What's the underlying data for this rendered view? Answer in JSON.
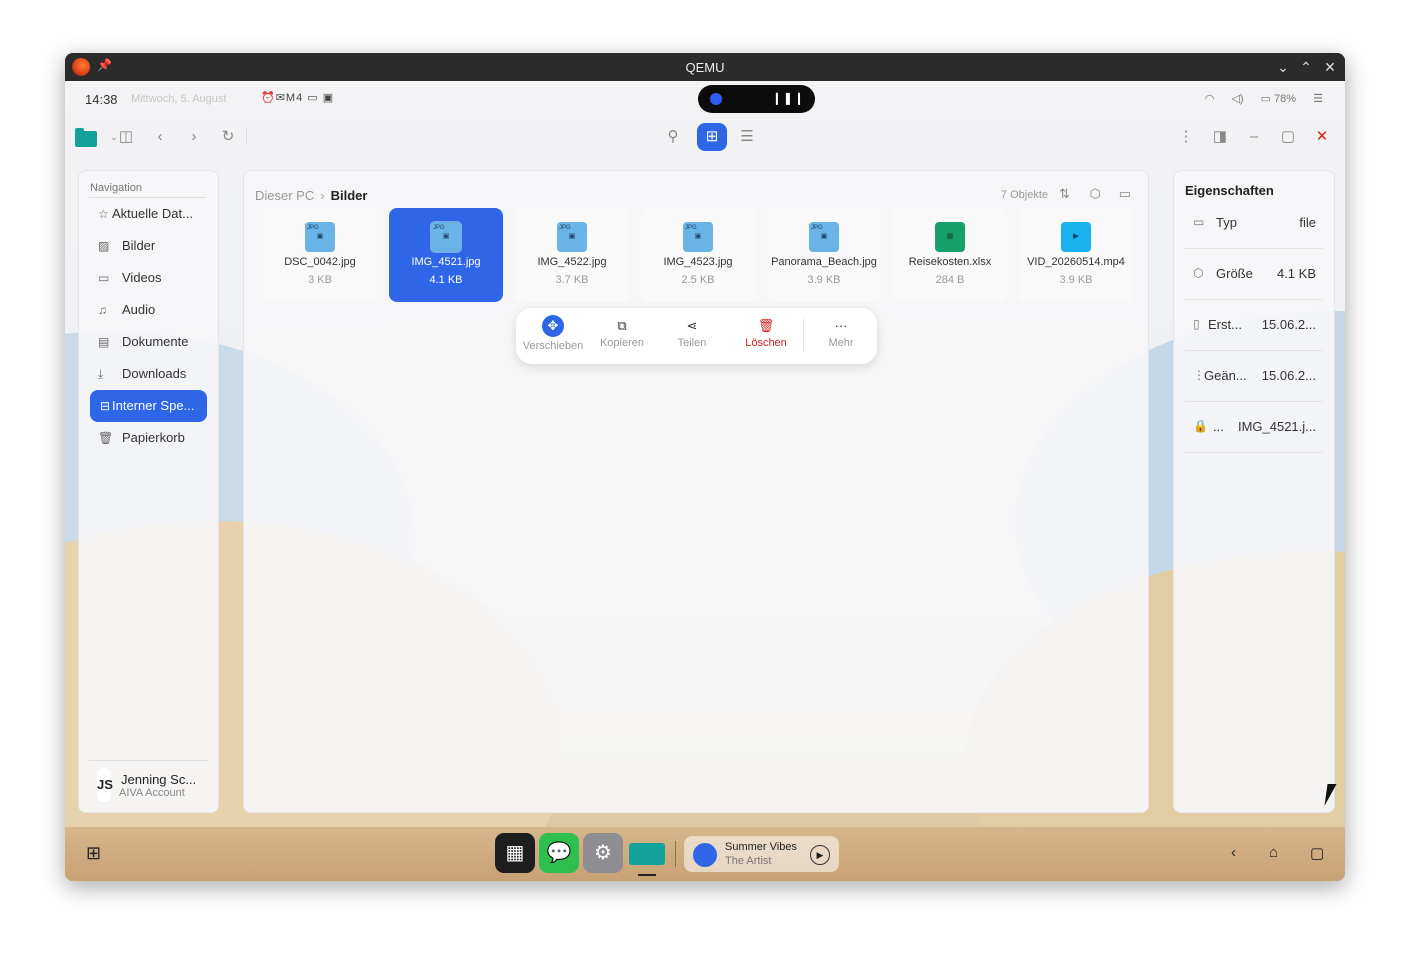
{
  "window": {
    "title": "QEMU"
  },
  "status": {
    "time": "14:38",
    "date": "Mittwoch, 5. August",
    "notif_text": "M4",
    "battery": "78%",
    "accent": "#2f66e8"
  },
  "navigation": {
    "heading": "Navigation",
    "items": [
      {
        "label": "Aktuelle Dat...",
        "icon": "star-icon"
      },
      {
        "label": "Bilder",
        "icon": "image-icon"
      },
      {
        "label": "Videos",
        "icon": "video-icon"
      },
      {
        "label": "Audio",
        "icon": "music-icon"
      },
      {
        "label": "Dokumente",
        "icon": "document-icon"
      },
      {
        "label": "Downloads",
        "icon": "download-icon"
      },
      {
        "label": "Interner Spe...",
        "icon": "drive-icon",
        "active": true
      },
      {
        "label": "Papierkorb",
        "icon": "trash-icon"
      }
    ],
    "account": {
      "initials": "JS",
      "name": "Jenning Sc...",
      "subtitle": "AIVA Account"
    }
  },
  "breadcrumb": {
    "parent": "Dieser PC",
    "current": "Bilder"
  },
  "object_count": "7 Objekte",
  "files": [
    {
      "name": "DSC_0042.jpg",
      "size": "3 KB",
      "type": "jpg"
    },
    {
      "name": "IMG_4521.jpg",
      "size": "4.1 KB",
      "type": "jpg",
      "selected": true
    },
    {
      "name": "IMG_4522.jpg",
      "size": "3.7 KB",
      "type": "jpg"
    },
    {
      "name": "IMG_4523.jpg",
      "size": "2.5 KB",
      "type": "jpg"
    },
    {
      "name": "Panorama_Beach.jpg",
      "size": "3.9 KB",
      "type": "jpg"
    },
    {
      "name": "Reisekosten.xlsx",
      "size": "284 B",
      "type": "xlsx"
    },
    {
      "name": "VID_20260514.mp4",
      "size": "3.9 KB",
      "type": "mp4"
    }
  ],
  "actions": [
    {
      "label": "Verschieben",
      "icon": "move-icon"
    },
    {
      "label": "Kopieren",
      "icon": "copy-icon"
    },
    {
      "label": "Teilen",
      "icon": "share-icon"
    },
    {
      "label": "Löschen",
      "icon": "trash-icon"
    },
    {
      "label": "Mehr",
      "icon": "more-icon"
    }
  ],
  "properties": {
    "title": "Eigenschaften",
    "rows": [
      {
        "key": "Typ",
        "value": "file",
        "icon": "folder-icon"
      },
      {
        "key": "Größe",
        "value": "4.1 KB",
        "icon": "cube-icon"
      },
      {
        "key": "Erst...",
        "value": "15.06.2...",
        "icon": "calendar-icon"
      },
      {
        "key": "Geän...",
        "value": "15.06.2...",
        "icon": "edit-icon"
      },
      {
        "key": "...",
        "value": "IMG_4521.j...",
        "icon": "lock-icon"
      }
    ]
  },
  "taskbar": {
    "music": {
      "title": "Summer Vibes",
      "artist": "The Artist"
    }
  }
}
